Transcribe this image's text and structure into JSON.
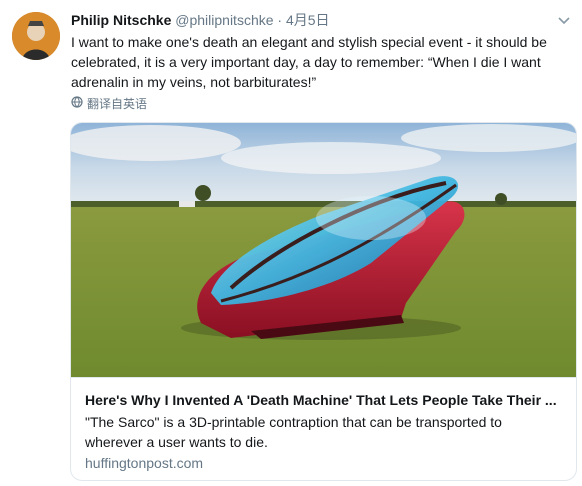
{
  "tweet": {
    "author_name": "Philip Nitschke",
    "author_handle": "@philipnitschke",
    "separator": "·",
    "date": "4月5日",
    "text": "I want to make one's death an elegant and stylish special event - it should be celebrated, it is a very important day, a day to remember: “When I die I want adrenalin in my veins, not barbiturates!”",
    "translate_label": "翻译自英语"
  },
  "card": {
    "title": "Here's Why I Invented A 'Death Machine' That Lets People Take Their ...",
    "description": "\"The Sarco\" is a 3D-printable contraption that can be transported to wherever a user wants to die.",
    "domain": "huffingtonpost.com"
  },
  "icons": {
    "more": "chevron-down-icon",
    "translate": "globe-icon"
  },
  "colors": {
    "text_primary": "#14171a",
    "text_secondary": "#657786",
    "border": "#e1e8ed"
  }
}
